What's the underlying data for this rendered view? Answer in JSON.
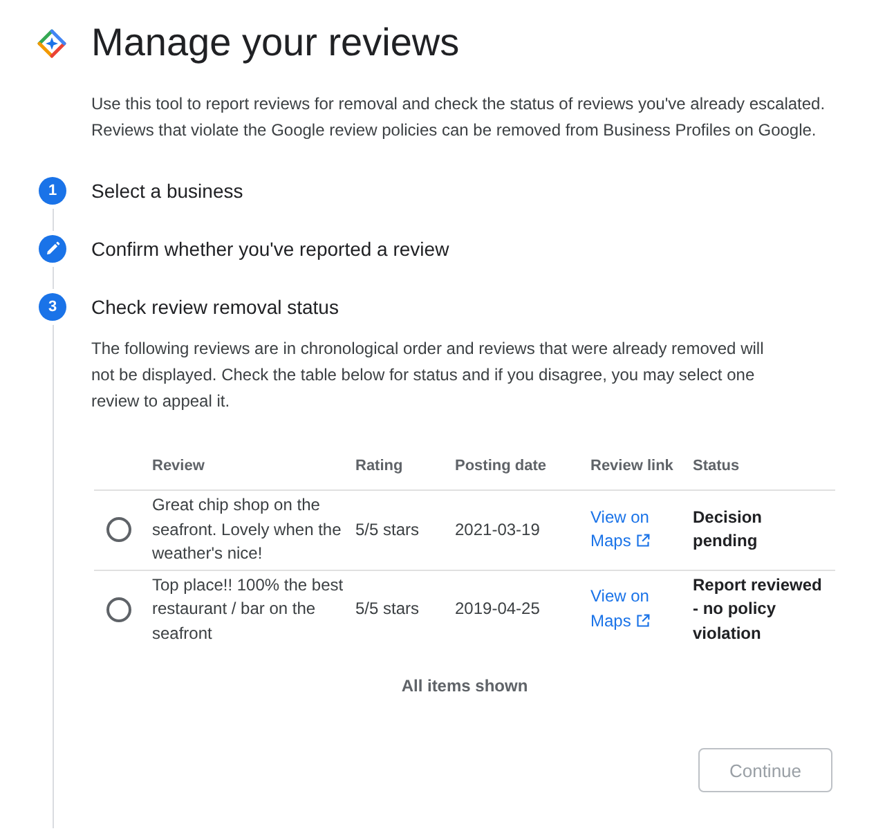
{
  "header": {
    "title": "Manage your reviews",
    "description": "Use this tool to report reviews for removal and check the status of reviews you've already escalated. Reviews that violate the Google review policies can be removed from Business Profiles on Google."
  },
  "steps": [
    {
      "kind": "number",
      "number": "1",
      "label": "Select a business"
    },
    {
      "kind": "edit",
      "label": "Confirm whether you've reported a review"
    },
    {
      "kind": "number",
      "number": "3",
      "label": "Check review removal status",
      "details": {
        "intro": "The following reviews are in chronological order and reviews that were already removed will not be displayed. Check the table below for status and if you disagree, you may select one review to appeal it.",
        "table": {
          "columns": [
            "Review",
            "Rating",
            "Posting date",
            "Review link",
            "Status"
          ],
          "rows": [
            {
              "selected": false,
              "review": "Great chip shop on the seafront. Lovely when the weather's nice!",
              "rating": "5/5 stars",
              "posting_date": "2021-03-19",
              "review_link": "View on Maps",
              "status": "Decision pending"
            },
            {
              "selected": false,
              "review": "Top place!! 100% the best restaurant / bar on the seafront",
              "rating": "5/5 stars",
              "posting_date": "2019-04-25",
              "review_link": "View on Maps",
              "status": "Report reviewed - no policy violation"
            }
          ]
        },
        "footer": "All items shown",
        "continue_button": {
          "label": "Continue",
          "disabled": true
        }
      }
    }
  ]
}
